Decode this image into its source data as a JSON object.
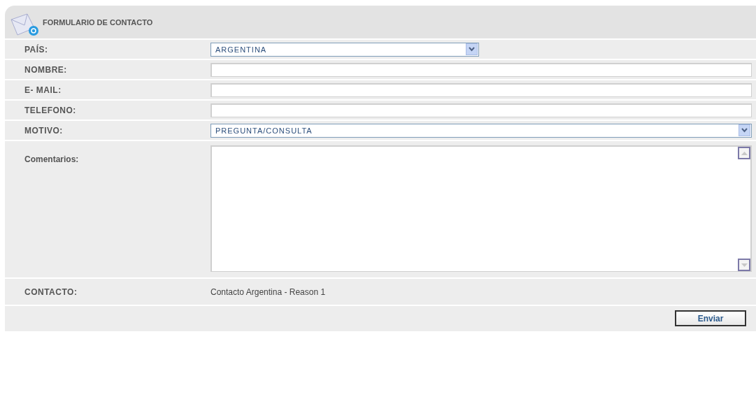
{
  "header": {
    "title": "FORMULARIO DE CONTACTO"
  },
  "rows": [
    {
      "kind": "select",
      "label": "PAÍS:",
      "value": "ARGENTINA",
      "wide": false
    },
    {
      "kind": "text",
      "label": "NOMBRE:"
    },
    {
      "kind": "text",
      "label": "E- MAIL:"
    },
    {
      "kind": "text",
      "label": "TELEFONO:"
    },
    {
      "kind": "select",
      "label": "MOTIVO:",
      "value": "PREGUNTA/CONSULTA",
      "wide": true
    },
    {
      "kind": "textarea",
      "label": "Comentarios:"
    },
    {
      "kind": "static",
      "label": "CONTACTO:",
      "value": "Contacto Argentina - Reason 1"
    }
  ],
  "submit": {
    "label": "Enviar"
  }
}
